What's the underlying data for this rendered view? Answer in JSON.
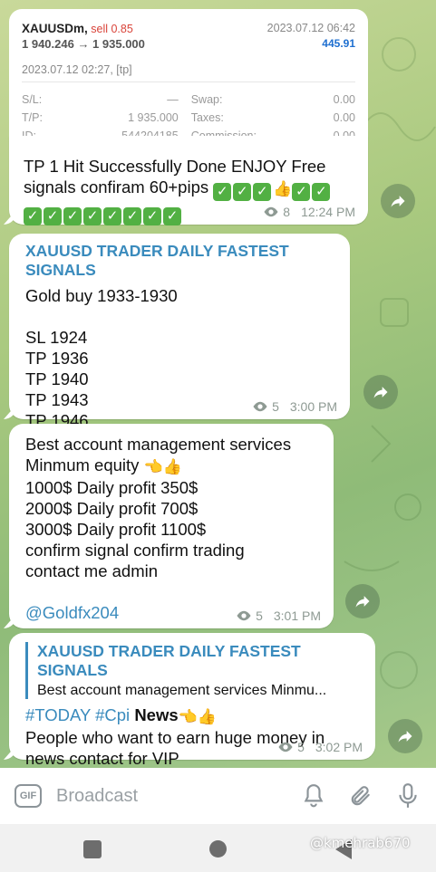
{
  "trade_card": {
    "symbol": "XAUUSDm,",
    "side": "sell 0.85",
    "timestamp": "2023.07.12 06:42",
    "price_change": "1 940.246 → 1 935.000",
    "profit": "445.91",
    "open_time": "2023.07.12 02:27, [tp]",
    "rows": [
      {
        "l1": "S/L:",
        "v1": "—",
        "l2": "Swap:",
        "v2": "0.00"
      },
      {
        "l1": "T/P:",
        "v1": "1 935.000",
        "l2": "Taxes:",
        "v2": "0.00"
      },
      {
        "l1": "ID:",
        "v1": "544204185",
        "l2": "Commission:",
        "v2": "0.00"
      }
    ]
  },
  "messages": [
    {
      "line1": "TP 1 Hit Successfully Done ENJOY Free",
      "line2": "signals confiram 60+pips",
      "views": "8",
      "time": "12:24 PM"
    },
    {
      "sender": "XAUUSD TRADER DAILY FASTEST SIGNALS",
      "lines": [
        "Gold buy 1933-1930",
        "",
        "SL 1924",
        "TP 1936",
        "TP 1940",
        "TP 1943",
        "TP 1946"
      ],
      "views": "5",
      "time": "3:00 PM"
    },
    {
      "lines": [
        "Best account management services",
        "Minmum equity",
        "1000$ Daily profit 350$",
        "2000$ Daily profit 700$",
        "3000$ Daily profit 1100$",
        "confirm signal confirm trading",
        "contact me admin"
      ],
      "mention": "@Goldfx204",
      "views": "5",
      "time": "3:01 PM"
    },
    {
      "reply_sender": "XAUUSD TRADER DAILY FASTEST SIGNALS",
      "reply_text": "Best account management services Minmu...",
      "hashtags": "#TODAY #Cpi",
      "news": "News",
      "line2": "People who want to earn huge money in",
      "line3": "news contact for VIP",
      "views": "5",
      "time": "3:02 PM"
    }
  ],
  "input": {
    "gif_label": "GIF",
    "placeholder": "Broadcast"
  },
  "watermark": "@kmehrab670",
  "colors": {
    "accent": "#3a8bbd",
    "check_green": "#52b043",
    "sell_red": "#d9443a",
    "profit_blue": "#1e6fd0"
  }
}
